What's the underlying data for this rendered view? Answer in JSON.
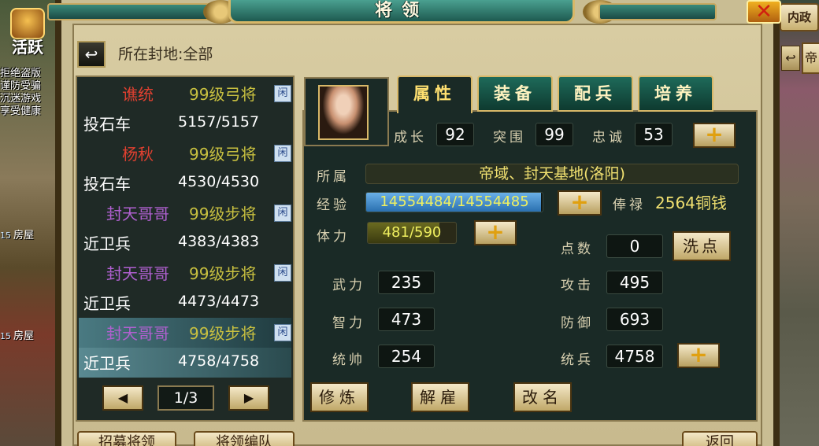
{
  "window": {
    "title": "将领",
    "close_label": "✕"
  },
  "sidebar_left": {
    "activity_label": "活跃",
    "notice_lines": [
      "拒绝盗版",
      "谨防受骗",
      "沉迷游戏",
      "享受健康"
    ],
    "houses": [
      {
        "level": "15",
        "label": "房屋"
      },
      {
        "level": "15",
        "label": "房屋"
      }
    ]
  },
  "sidebar_right": {
    "top_tab": "内政",
    "side_btn": "帝"
  },
  "filter": {
    "back_icon": "↩",
    "fief_label": "所在封地:全部"
  },
  "generals": [
    {
      "name": "谯统",
      "name_color": "#e04030",
      "level": "99级弓将",
      "badge": "闲",
      "unit": "投石车",
      "count": "5157/5157",
      "selected": false
    },
    {
      "name": "杨秋",
      "name_color": "#e04030",
      "level": "99级弓将",
      "badge": "闲",
      "unit": "投石车",
      "count": "4530/4530",
      "selected": false
    },
    {
      "name": "封天哥哥",
      "name_color": "#b060d0",
      "level": "99级步将",
      "badge": "闲",
      "unit": "近卫兵",
      "count": "4383/4383",
      "selected": false
    },
    {
      "name": "封天哥哥",
      "name_color": "#b060d0",
      "level": "99级步将",
      "badge": "闲",
      "unit": "近卫兵",
      "count": "4473/4473",
      "selected": false
    },
    {
      "name": "封天哥哥",
      "name_color": "#b060d0",
      "level": "99级步将",
      "badge": "闲",
      "unit": "近卫兵",
      "count": "4758/4758",
      "selected": true
    }
  ],
  "pager": {
    "prev_icon": "◀",
    "next_icon": "▶",
    "page": "1/3"
  },
  "bottom_buttons": [
    "招募将领",
    "将领编队",
    "返回"
  ],
  "tabs": [
    {
      "label": "属性",
      "active": true
    },
    {
      "label": "装备",
      "active": false
    },
    {
      "label": "配兵",
      "active": false
    },
    {
      "label": "培养",
      "active": false
    }
  ],
  "detail": {
    "growth_label": "成长",
    "growth": "92",
    "assault_label": "突围",
    "assault": "99",
    "loyalty_label": "忠诚",
    "loyalty": "53",
    "owner_label": "所属",
    "owner": "帝域、封天基地(洛阳)",
    "exp_label": "经验",
    "exp": "14554484/14554485",
    "exp_ratio": 0.99,
    "salary_label": "俸禄",
    "salary": "2564铜钱",
    "stamina_label": "体力",
    "stamina": "481/590",
    "stamina_ratio": 0.815,
    "points_label": "点数",
    "points": "0",
    "reset_label": "洗点",
    "force_label": "武力",
    "force": "235",
    "intellect_label": "智力",
    "intellect": "473",
    "command_label": "统帅",
    "command": "254",
    "attack_label": "攻击",
    "attack": "495",
    "defense_label": "防御",
    "defense": "693",
    "troops_label": "统兵",
    "troops": "4758",
    "plus_icon": "+",
    "train_label": "修炼",
    "dismiss_label": "解雇",
    "rename_label": "改名"
  }
}
